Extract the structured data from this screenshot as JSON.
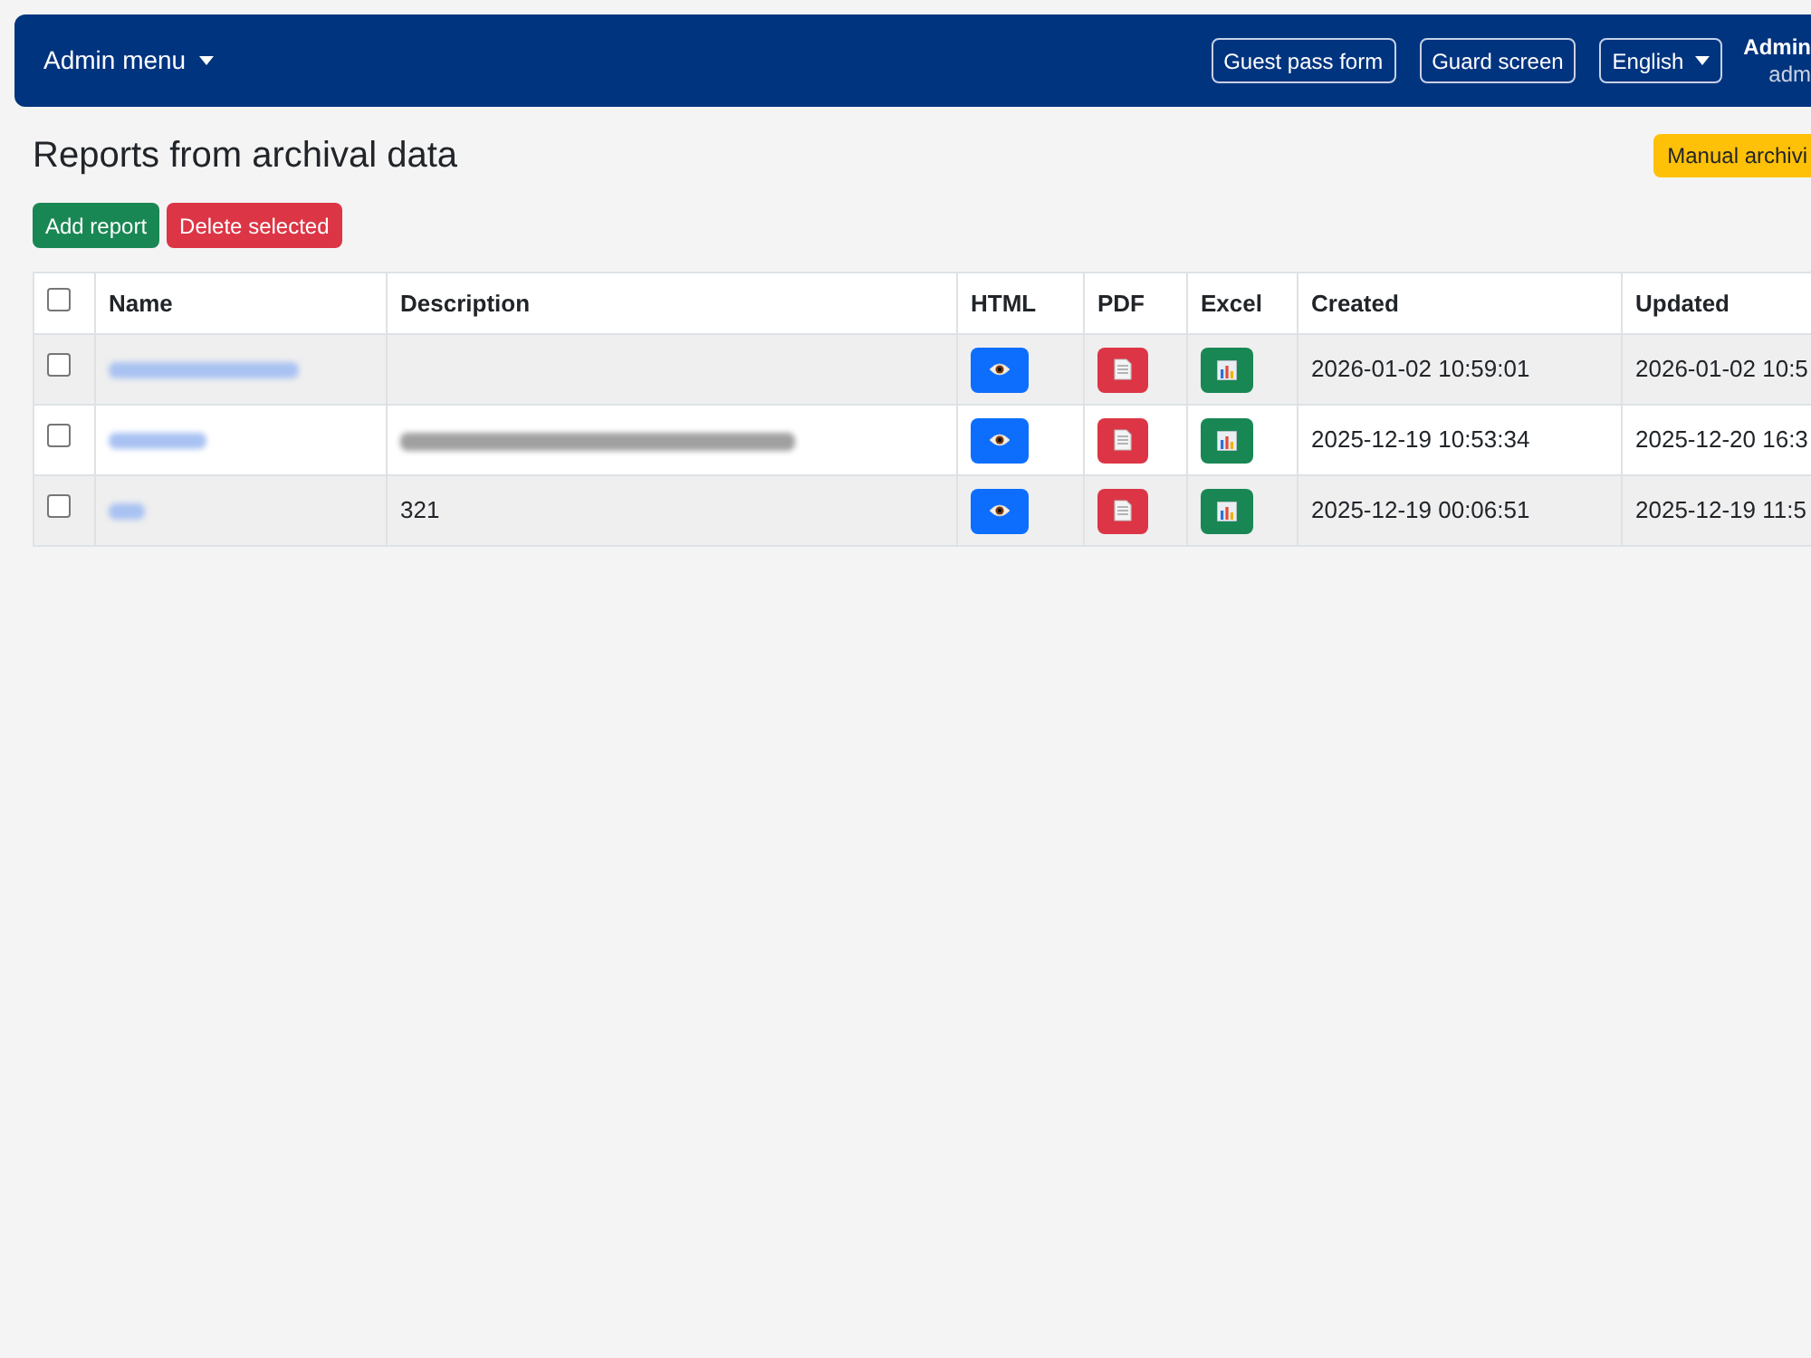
{
  "navbar": {
    "menu": {
      "label": "Admin menu"
    },
    "buttons": [
      {
        "label": "Guest pass form"
      },
      {
        "label": "Guard screen"
      }
    ],
    "language": {
      "label": "English"
    },
    "user": {
      "name": "Admin",
      "login": "adm"
    }
  },
  "page": {
    "title": "Reports from archival data",
    "archive_button": {
      "label": "Manual archivi"
    },
    "actions": [
      {
        "label": "Add report",
        "kind": "success"
      },
      {
        "label": "Delete selected",
        "kind": "danger"
      }
    ]
  },
  "table": {
    "select_all": {
      "checked": false
    },
    "columns": [
      "Name",
      "Description",
      "HTML",
      "PDF",
      "Excel",
      "Created",
      "Updated"
    ],
    "rows": [
      {
        "checked": false,
        "name": {
          "kind": "redacted"
        },
        "created": "2026-01-02 10:59:01",
        "updated": "2026-01-02 10:5"
      },
      {
        "checked": false,
        "name": {
          "kind": "redacted"
        },
        "description": {
          "kind": "redacted"
        },
        "created": "2025-12-19 10:53:34",
        "updated": "2025-12-20 16:3"
      },
      {
        "checked": false,
        "name": {
          "kind": "redacted"
        },
        "description": {
          "kind": "text",
          "text": "321"
        },
        "created": "2025-12-19 00:06:51",
        "updated": "2025-12-19 11:5"
      }
    ]
  }
}
